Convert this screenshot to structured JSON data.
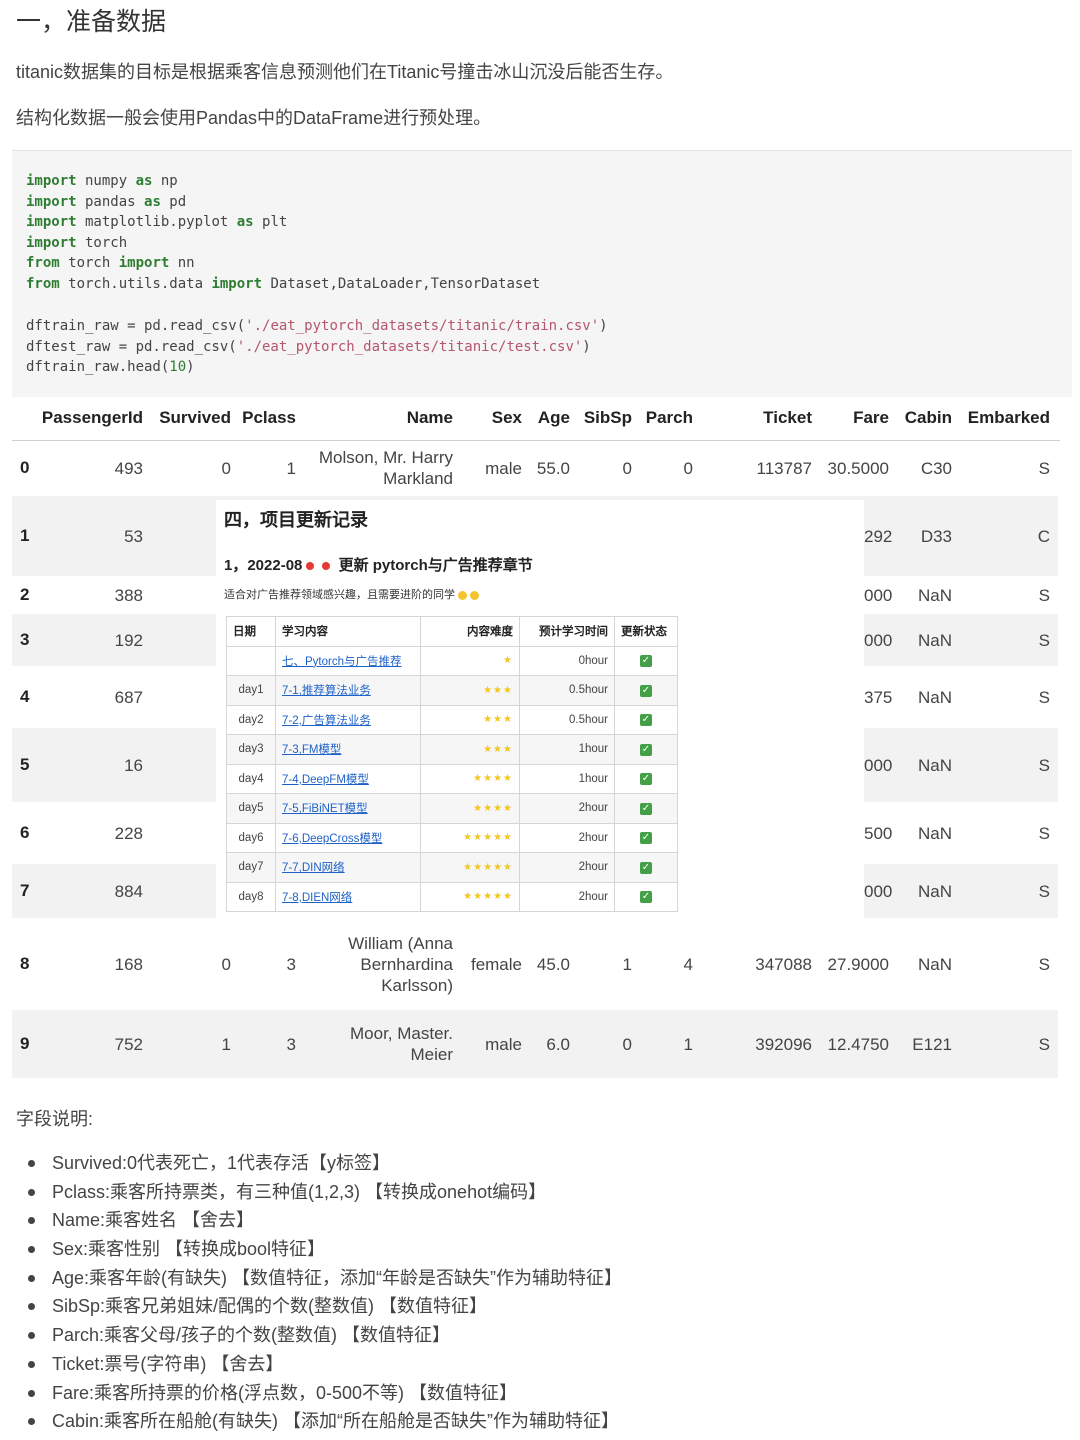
{
  "heading": "一，准备数据",
  "paragraphs": [
    "titanic数据集的目标是根据乘客信息预测他们在Titanic号撞击冰山沉没后能否生存。",
    "结构化数据一般会使用Pandas中的DataFrame进行预处理。"
  ],
  "code": {
    "lines": [
      [
        {
          "t": "import",
          "c": "kw"
        },
        {
          "t": " numpy "
        },
        {
          "t": "as",
          "c": "kw"
        },
        {
          "t": " np"
        }
      ],
      [
        {
          "t": "import",
          "c": "kw"
        },
        {
          "t": " pandas "
        },
        {
          "t": "as",
          "c": "kw"
        },
        {
          "t": " pd"
        }
      ],
      [
        {
          "t": "import",
          "c": "kw"
        },
        {
          "t": " matplotlib.pyplot "
        },
        {
          "t": "as",
          "c": "kw"
        },
        {
          "t": " plt"
        }
      ],
      [
        {
          "t": "import",
          "c": "kw"
        },
        {
          "t": " torch"
        }
      ],
      [
        {
          "t": "from",
          "c": "kw"
        },
        {
          "t": " torch "
        },
        {
          "t": "import",
          "c": "kw"
        },
        {
          "t": " nn"
        }
      ],
      [
        {
          "t": "from",
          "c": "kw"
        },
        {
          "t": " torch.utils.data "
        },
        {
          "t": "import",
          "c": "kw"
        },
        {
          "t": " Dataset,DataLoader,TensorDataset"
        }
      ],
      [],
      [
        {
          "t": "dftrain_raw = pd.read_csv("
        },
        {
          "t": "'./eat_pytorch_datasets/titanic/train.csv'",
          "c": "str"
        },
        {
          "t": ")"
        }
      ],
      [
        {
          "t": "dftest_raw = pd.read_csv("
        },
        {
          "t": "'./eat_pytorch_datasets/titanic/test.csv'",
          "c": "str"
        },
        {
          "t": ")"
        }
      ],
      [
        {
          "t": "dftrain_raw.head("
        },
        {
          "t": "10",
          "c": "num"
        },
        {
          "t": ")"
        }
      ]
    ]
  },
  "dataframe": {
    "columns": [
      "PassengerId",
      "Survived",
      "Pclass",
      "Name",
      "Sex",
      "Age",
      "SibSp",
      "Parch",
      "Ticket",
      "Fare",
      "Cabin",
      "Embarked"
    ],
    "rows": [
      {
        "index": "0",
        "PassengerId": "493",
        "Survived": "0",
        "Pclass": "1",
        "Name": [
          "Molson, Mr. Harry",
          "Markland"
        ],
        "Sex": "male",
        "Age": "55.0",
        "SibSp": "0",
        "Parch": "0",
        "Ticket": "113787",
        "Fare": "30.5000",
        "Cabin": "C30",
        "Embarked": "S"
      },
      {
        "index": "1",
        "PassengerId": "53",
        "Cabin": "D33",
        "Embarked": "C",
        "TicketFrag": "292"
      },
      {
        "index": "2",
        "PassengerId": "388",
        "Cabin": "NaN",
        "Embarked": "S",
        "TicketFrag": "000"
      },
      {
        "index": "3",
        "PassengerId": "192",
        "Cabin": "NaN",
        "Embarked": "S",
        "TicketFrag": "000"
      },
      {
        "index": "4",
        "PassengerId": "687",
        "Cabin": "NaN",
        "Embarked": "S",
        "TicketFrag": "375"
      },
      {
        "index": "5",
        "PassengerId": "16",
        "Cabin": "NaN",
        "Embarked": "S",
        "TicketFrag": "000"
      },
      {
        "index": "6",
        "PassengerId": "228",
        "Cabin": "NaN",
        "Embarked": "S",
        "TicketFrag": "500"
      },
      {
        "index": "7",
        "PassengerId": "884",
        "Cabin": "NaN",
        "Embarked": "S",
        "TicketFrag": "000"
      },
      {
        "index": "8",
        "PassengerId": "168",
        "Survived": "0",
        "Pclass": "3",
        "Name": [
          "William (Anna",
          "Bernhardina",
          "Karlsson)"
        ],
        "Sex": "female",
        "Age": "45.0",
        "SibSp": "1",
        "Parch": "4",
        "Ticket": "347088",
        "Fare": "27.9000",
        "Cabin": "NaN",
        "Embarked": "S"
      },
      {
        "index": "9",
        "PassengerId": "752",
        "Survived": "1",
        "Pclass": "3",
        "Name": [
          "Moor, Master.",
          "Meier"
        ],
        "Sex": "male",
        "Age": "6.0",
        "SibSp": "0",
        "Parch": "1",
        "Ticket": "392096",
        "Fare": "12.4750",
        "Cabin": "E121",
        "Embarked": "S"
      }
    ]
  },
  "overlay": {
    "title": "四，项目更新记录",
    "subtitle_prefix": "1，2022-08",
    "subtitle_text": "更新 pytorch与广告推荐章节",
    "note": "适合对广告推荐领域感兴趣，且需要进阶的同学",
    "plan_headers": [
      "日期",
      "学习内容",
      "内容难度",
      "预计学习时间",
      "更新状态"
    ],
    "plan_rows": [
      {
        "day": "",
        "content": "七、Pytorch与广告推荐",
        "stars": "★",
        "hours": "0hour"
      },
      {
        "day": "day1",
        "content": "7-1,推荐算法业务",
        "stars": "★★★",
        "hours": "0.5hour"
      },
      {
        "day": "day2",
        "content": "7-2,广告算法业务",
        "stars": "★★★",
        "hours": "0.5hour"
      },
      {
        "day": "day3",
        "content": "7-3,FM模型",
        "stars": "★★★",
        "hours": "1hour"
      },
      {
        "day": "day4",
        "content": "7-4,DeepFM模型",
        "stars": "★★★★",
        "hours": "1hour"
      },
      {
        "day": "day5",
        "content": "7-5,FiBiNET模型",
        "stars": "★★★★",
        "hours": "2hour"
      },
      {
        "day": "day6",
        "content": "7-6,DeepCross模型",
        "stars": "★★★★★",
        "hours": "2hour"
      },
      {
        "day": "day7",
        "content": "7-7,DIN网络",
        "stars": "★★★★★",
        "hours": "2hour"
      },
      {
        "day": "day8",
        "content": "7-8,DIEN网络",
        "stars": "★★★★★",
        "hours": "2hour"
      }
    ],
    "check_glyph": "✓"
  },
  "fields_title": "字段说明:",
  "fields": [
    "Survived:0代表死亡，1代表存活【y标签】",
    "Pclass:乘客所持票类，有三种值(1,2,3) 【转换成onehot编码】",
    "Name:乘客姓名 【舍去】",
    "Sex:乘客性别 【转换成bool特征】",
    "Age:乘客年龄(有缺失) 【数值特征，添加“年龄是否缺失”作为辅助特征】",
    "SibSp:乘客兄弟姐妹/配偶的个数(整数值) 【数值特征】",
    "Parch:乘客父母/孩子的个数(整数值) 【数值特征】",
    "Ticket:票号(字符串) 【舍去】",
    "Fare:乘客所持票的价格(浮点数，0-500不等) 【数值特征】",
    "Cabin:乘客所在船舱(有缺失) 【添加“所在船舱是否缺失”作为辅助特征】"
  ]
}
